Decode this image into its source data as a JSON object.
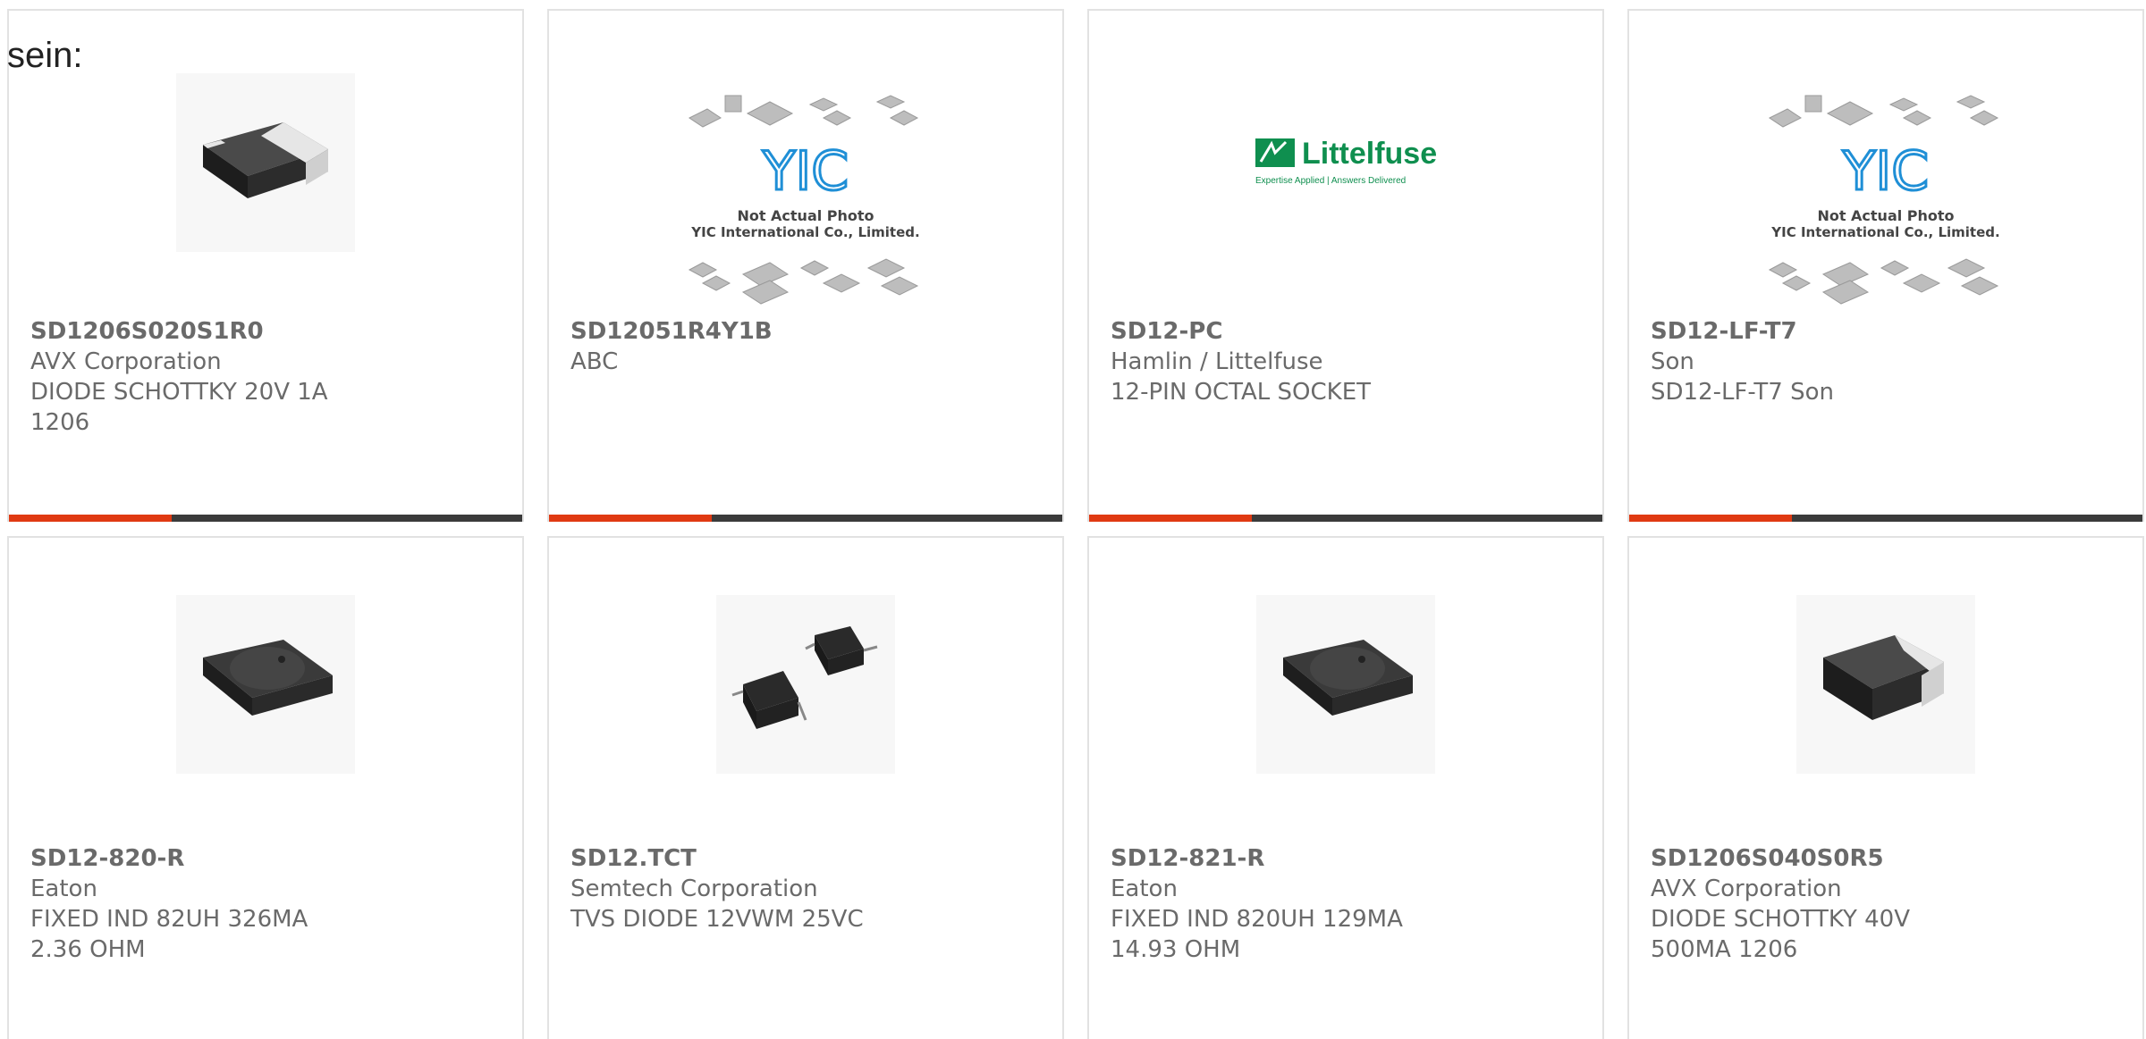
{
  "heading": "sein:",
  "colors": {
    "accent": "#e03a12",
    "bar_dark": "#3b3b3b",
    "text_gray": "#6a6a6a",
    "card_border": "#e2e2e2",
    "littelfuse_green": "#0f8f4f",
    "yic_blue": "#1f8fd6"
  },
  "products": [
    {
      "part_number": "SD1206S020S1R0",
      "manufacturer": "AVX Corporation",
      "description": "DIODE SCHOTTKY 20V 1A 1206",
      "image": "smd-diode-photo"
    },
    {
      "part_number": "SD12051R4Y1B",
      "manufacturer": "ABC",
      "description": "",
      "image": "yic-placeholder",
      "image_text_1": "Not Actual Photo",
      "image_text_2": "YIC International Co., Limited.",
      "image_logo": "YIC"
    },
    {
      "part_number": "SD12-PC",
      "manufacturer": "Hamlin / Littelfuse",
      "description": "12-PIN OCTAL SOCKET",
      "image": "littelfuse-logo",
      "image_logo": "Littelfuse",
      "image_tagline": "Expertise Applied | Answers Delivered"
    },
    {
      "part_number": "SD12-LF-T7",
      "manufacturer": "Son",
      "description": "SD12-LF-T7 Son",
      "image": "yic-placeholder",
      "image_text_1": "Not Actual Photo",
      "image_text_2": "YIC International Co., Limited.",
      "image_logo": "YIC"
    },
    {
      "part_number": "SD12-820-R",
      "manufacturer": "Eaton",
      "description": "FIXED IND 82UH 326MA 2.36 OHM",
      "image": "smd-inductor-photo"
    },
    {
      "part_number": "SD12.TCT",
      "manufacturer": "Semtech Corporation",
      "description": "TVS DIODE 12VWM 25VC",
      "image": "tvs-diode-photo"
    },
    {
      "part_number": "SD12-821-R",
      "manufacturer": "Eaton",
      "description": "FIXED IND 820UH 129MA 14.93 OHM",
      "image": "smd-inductor-photo"
    },
    {
      "part_number": "SD1206S040S0R5",
      "manufacturer": "AVX Corporation",
      "description": "DIODE SCHOTTKY 40V 500MA 1206",
      "image": "smd-diode-photo"
    }
  ]
}
